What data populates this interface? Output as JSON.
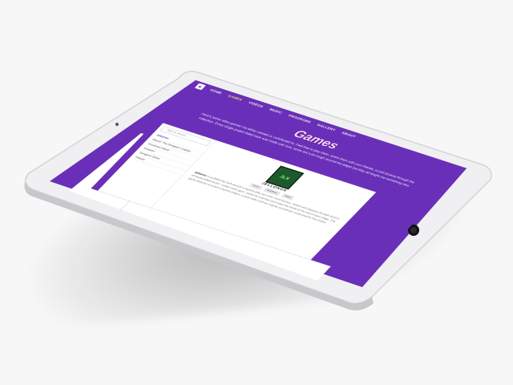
{
  "nav": {
    "links": [
      "HOME",
      "GAMES",
      "VIDEOS",
      "MUSIC",
      "PROGRAMS",
      "GALLERY",
      "ABOUT"
    ],
    "active_index": 1
  },
  "hero": {
    "title": "Games",
    "text": "Here's some video games I've either created or contributed to. Feel free to play them, share them with your friends, or just browse through the collection. Every single project listed here was made with love, some are a bit rough around the edges but they all taught me something new."
  },
  "sidebar": {
    "search_placeholder": "Type to search...",
    "items": [
      "Jellonox",
      "Planet: The Dungeon Crawler",
      "Knockout Island",
      "Invasion",
      "Dungeon Delve",
      "Hopper"
    ],
    "active_index": 0
  },
  "game": {
    "cover_text": "JLX",
    "title": "JELLONOX",
    "tags": [
      "PLAY",
      "SOURCE",
      "INFO"
    ],
    "description_lead": "Jellonox",
    "description": " is a platformer built around a squishy jelly hero who must bounce, stretch and squeeze through dozens of hand-crafted levels. Collect every gem, outwit the enemies and reach the portal at the end of each stage. The game features a custom physics engine, a level editor and an original soundtrack composed for the project."
  },
  "colors": {
    "accent": "#6a2fb8",
    "title": "#ffd4f6",
    "active_link": "#ffe16a",
    "device_frame": "#f0f0f2"
  }
}
